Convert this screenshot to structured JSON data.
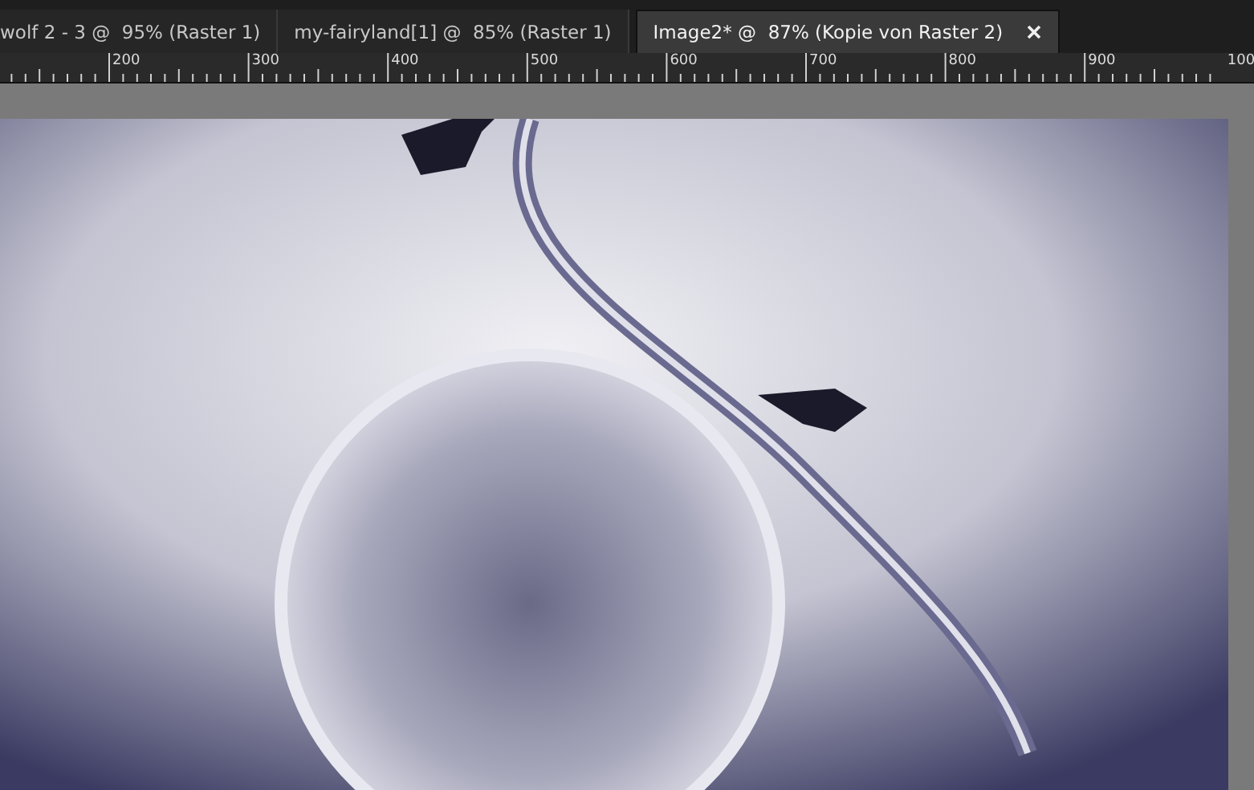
{
  "tabs": [
    {
      "label": "wolf 2 - 3 @  95% (Raster 1)",
      "selected": false
    },
    {
      "label": "my-fairyland[1] @  85% (Raster 1)",
      "selected": false
    },
    {
      "label": "Image2* @  87% (Kopie von Raster 2)",
      "selected": true
    }
  ],
  "ruler": {
    "labels": [
      "200",
      "300",
      "400",
      "500",
      "600",
      "700",
      "800",
      "900",
      "100"
    ]
  }
}
